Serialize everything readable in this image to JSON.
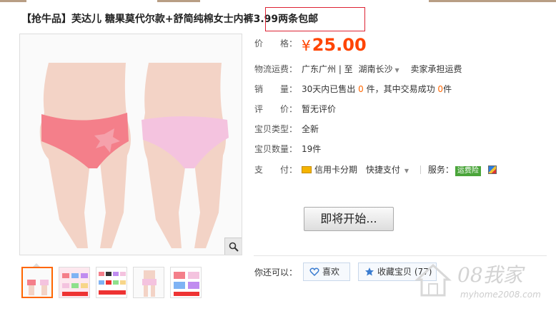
{
  "title": {
    "text": "【抢牛品】芙达儿 糖果莫代尔款+舒简纯棉女士内裤3.99两条包邮"
  },
  "product": {
    "price_label": "价　　格：",
    "price_symbol": "¥",
    "price_value": "25.00",
    "shipping_label": "物流运费：",
    "shipping_from": "广东广州 | 至",
    "shipping_to": "湖南长沙",
    "shipping_note": "卖家承担运费",
    "sales_label": "销　　量：",
    "sales_prefix": "30天内已售出",
    "sales_count": "0",
    "sales_mid": "件，其中交易成功",
    "sales_success": "0",
    "sales_suffix": "件",
    "review_label": "评　　价：",
    "review_value": "暂无评价",
    "type_label": "宝贝类型：",
    "type_value": "全新",
    "qty_label": "宝贝数量：",
    "qty_value": "19件",
    "pay_label": "支　　付：",
    "pay_credit": "信用卡分期",
    "pay_fast": "快捷支付",
    "service_label": "服务：",
    "service_badge": "运费险"
  },
  "actions": {
    "start_label": "即将开始...",
    "also_label": "你还可以：",
    "like_label": "喜欢",
    "fav_label": "收藏宝贝 (77)"
  },
  "watermark": {
    "line1": "08我家",
    "line2": "myhome2008.com"
  },
  "icons": [
    "zoom-icon",
    "credit-card-icon",
    "heart-icon",
    "star-icon",
    "chevron-down-icon"
  ],
  "colors": {
    "price": "#ff4400",
    "highlight_border": "#dd2233",
    "insure_badge": "#4aa53a",
    "accent": "#ff6600"
  }
}
